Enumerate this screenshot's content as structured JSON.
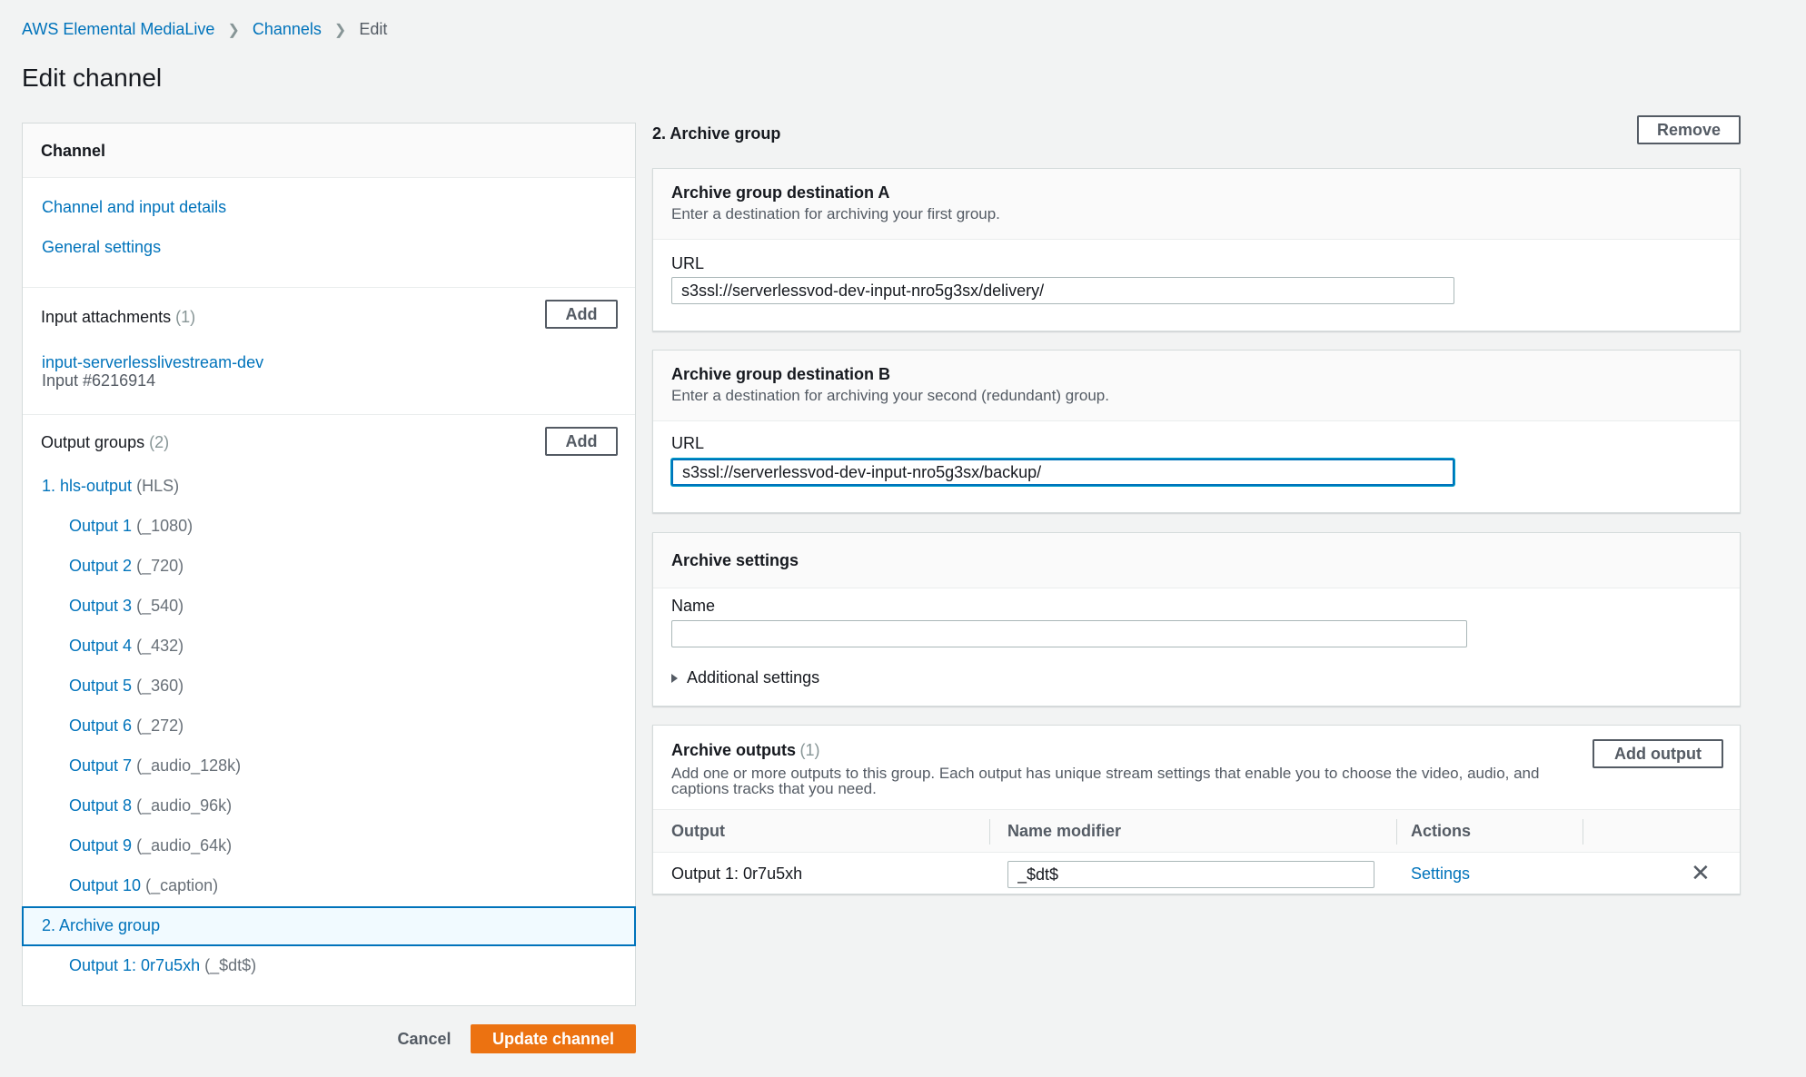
{
  "breadcrumb": {
    "items": [
      "AWS Elemental MediaLive",
      "Channels"
    ],
    "current": "Edit"
  },
  "page_title": "Edit channel",
  "left_panel": {
    "header": "Channel",
    "links": [
      "Channel and input details",
      "General settings"
    ],
    "input_attachments": {
      "label": "Input attachments",
      "count": "(1)",
      "add_label": "Add",
      "input_name": "input-serverlesslivestream-dev",
      "input_id": "Input #6216914"
    },
    "output_groups": {
      "label": "Output groups",
      "count": "(2)",
      "add_label": "Add",
      "group1": {
        "name": "1. hls-output",
        "type": "(HLS)"
      },
      "outputs": [
        {
          "name": "Output 1",
          "suffix": "(_1080)"
        },
        {
          "name": "Output 2",
          "suffix": "(_720)"
        },
        {
          "name": "Output 3",
          "suffix": "(_540)"
        },
        {
          "name": "Output 4",
          "suffix": "(_432)"
        },
        {
          "name": "Output 5",
          "suffix": "(_360)"
        },
        {
          "name": "Output 6",
          "suffix": "(_272)"
        },
        {
          "name": "Output 7",
          "suffix": "(_audio_128k)"
        },
        {
          "name": "Output 8",
          "suffix": "(_audio_96k)"
        },
        {
          "name": "Output 9",
          "suffix": "(_audio_64k)"
        },
        {
          "name": "Output 10",
          "suffix": "(_caption)"
        }
      ],
      "group2": {
        "name": "2. Archive group"
      },
      "group2_output": {
        "name": "Output 1: 0r7u5xh",
        "suffix": "(_$dt$)"
      }
    }
  },
  "footer": {
    "cancel_label": "Cancel",
    "update_label": "Update channel"
  },
  "archive_group": {
    "title": "2. Archive group",
    "remove_label": "Remove",
    "dest_a": {
      "title": "Archive group destination A",
      "description": "Enter a destination for archiving your first group.",
      "url_label": "URL",
      "url_value": "s3ssl://serverlessvod-dev-input-nro5g3sx/delivery/"
    },
    "dest_b": {
      "title": "Archive group destination B",
      "description": "Enter a destination for archiving your second (redundant) group.",
      "url_label": "URL",
      "url_value": "s3ssl://serverlessvod-dev-input-nro5g3sx/backup/"
    },
    "settings": {
      "title": "Archive settings",
      "name_label": "Name",
      "name_value": "",
      "additional_label": "Additional settings"
    },
    "outputs": {
      "title": "Archive outputs",
      "count": "(1)",
      "description": "Add one or more outputs to this group. Each output has unique stream settings that enable you to choose the video, audio, and captions tracks that you need.",
      "add_output_label": "Add output",
      "columns": [
        "Output",
        "Name modifier",
        "Actions"
      ],
      "rows": [
        {
          "output": "Output 1: 0r7u5xh",
          "name_modifier": "_$dt$",
          "action": "Settings"
        }
      ]
    }
  },
  "colors": {
    "link": "#0073bb",
    "primary_button": "#ec7211",
    "focus": "#0073bb"
  }
}
